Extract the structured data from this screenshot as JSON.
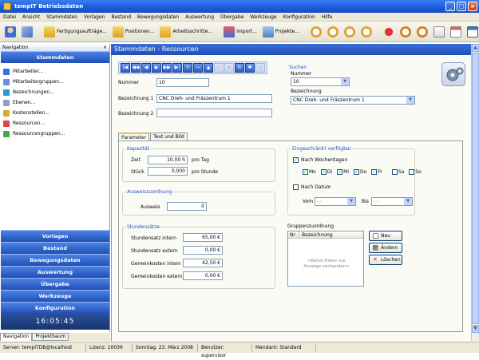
{
  "window": {
    "title": "tempIT Betriebsdaten"
  },
  "menu": [
    "Datei",
    "Ansicht",
    "Stammdaten",
    "Vorlagen",
    "Bestand",
    "Bewegungsdaten",
    "Auswertung",
    "Übergabe",
    "Werkzeuge",
    "Konfiguration",
    "Hilfe"
  ],
  "toolbar": {
    "items": [
      {
        "icon": "user-icon",
        "label": ""
      },
      {
        "icon": "group-icon",
        "label": ""
      },
      {
        "icon": "folder-icon",
        "label": "Fertigungsaufträge..."
      },
      {
        "icon": "folder-icon",
        "label": "Positionen..."
      },
      {
        "icon": "folder-icon",
        "label": "Arbeitsschritte..."
      },
      {
        "icon": "import-icon",
        "label": "Import..."
      },
      {
        "icon": "projects-icon",
        "label": "Projekte..."
      }
    ]
  },
  "nav": {
    "header": "Navigation",
    "section": "Stammdaten",
    "items": [
      "Mitarbeiter...",
      "Mitarbeitergruppen...",
      "Bezeichnungen...",
      "Ebenen...",
      "Kostenstellen...",
      "Ressourcen...",
      "Ressourcengruppen..."
    ],
    "sections": [
      "Vorlagen",
      "Bestand",
      "Bewegungsdaten",
      "Auswertung",
      "Übergabe",
      "Werkzeuge",
      "Konfiguration"
    ],
    "clock": "16:05:45",
    "tabs": [
      "Navigation",
      "Projektbaum"
    ]
  },
  "content": {
    "title": "Stammdaten - Ressourcen",
    "fields": {
      "nummer_label": "Nummer",
      "nummer_value": "10",
      "bez1_label": "Bezeichnung 1",
      "bez1_value": "CNC Dreh- und Fräszentrum 1",
      "bez2_label": "Bezeichnung 2",
      "bez2_value": ""
    },
    "search": {
      "title": "Suchen",
      "nummer_label": "Nummer",
      "nummer_value": "10",
      "bez_label": "Bezeichnung",
      "bez_value": "CNC Dreh- und Fräszentrum 1"
    },
    "tabs": [
      "Parameter",
      "Text und Bild"
    ],
    "kapazitaet": {
      "title": "Kapazität",
      "zeit_label": "Zeit",
      "zeit_value": "10,00 h",
      "zeit_unit": "pro Tag",
      "stueck_label": "Stück",
      "stueck_value": "0,000",
      "stueck_unit": "pro Stunde"
    },
    "ausweis": {
      "title": "Ausweiszuordnung",
      "label": "Ausweis",
      "value": "0"
    },
    "stundensaetze": {
      "title": "Stundensätze",
      "rows": [
        {
          "label": "Stundensatz intern",
          "value": "65,00 €"
        },
        {
          "label": "Stundensatz extern",
          "value": "0,00 €"
        },
        {
          "label": "Gemeinkosten intern",
          "value": "42,50 €"
        },
        {
          "label": "Gemeinkosten extern",
          "value": "0,00 €"
        }
      ]
    },
    "verfuegbar": {
      "title": "Eingeschränkt verfügbar",
      "wochentage_label": "Nach Wochentagen",
      "days": [
        {
          "label": "Mo",
          "checked": true
        },
        {
          "label": "Di",
          "checked": true
        },
        {
          "label": "Mi",
          "checked": true
        },
        {
          "label": "Do",
          "checked": true
        },
        {
          "label": "Fr",
          "checked": true
        },
        {
          "label": "Sa",
          "checked": false
        },
        {
          "label": "So",
          "checked": false
        }
      ],
      "datum_label": "Nach Datum",
      "vom_label": "Vom",
      "vom_value": "- -",
      "bis_label": "Bis",
      "bis_value": "- -"
    },
    "gruppen": {
      "title": "Gruppenzuordnung",
      "col_nr": "Nr",
      "col_bez": "Bezeichnung",
      "empty": "<Keine Daten zur Anzeige vorhanden>",
      "btn_new": "Neu",
      "btn_edit": "Ändern",
      "btn_delete": "Löschen"
    }
  },
  "status": [
    "Server: tempITDB@localhost",
    "Lizenz: 10036",
    "Sonntag, 23. März 2008",
    "Benutzer: supervisor",
    "Mandant: Standard"
  ]
}
